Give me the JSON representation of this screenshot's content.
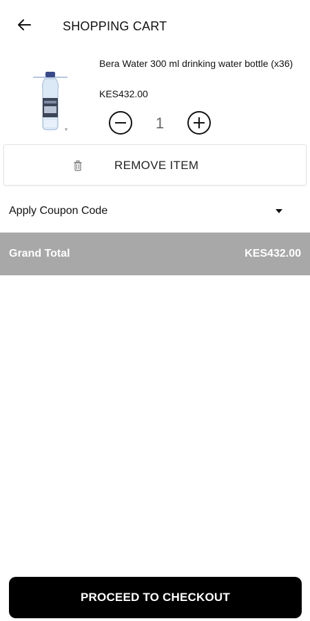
{
  "header": {
    "title": "SHOPPING CART",
    "back_icon": "arrow-left-icon"
  },
  "cart": {
    "item": {
      "name": "Bera Water 300 ml drinking water bottle (x36)",
      "price": "KES432.00",
      "quantity": "1"
    },
    "remove_label": "REMOVE ITEM"
  },
  "coupon": {
    "label": "Apply Coupon Code"
  },
  "total": {
    "label": "Grand Total",
    "value": "KES432.00"
  },
  "checkout": {
    "label": "PROCEED TO CHECKOUT"
  },
  "colors": {
    "accent": "#000000",
    "total_bar": "#a8a8a8",
    "background": "#ffffff"
  }
}
